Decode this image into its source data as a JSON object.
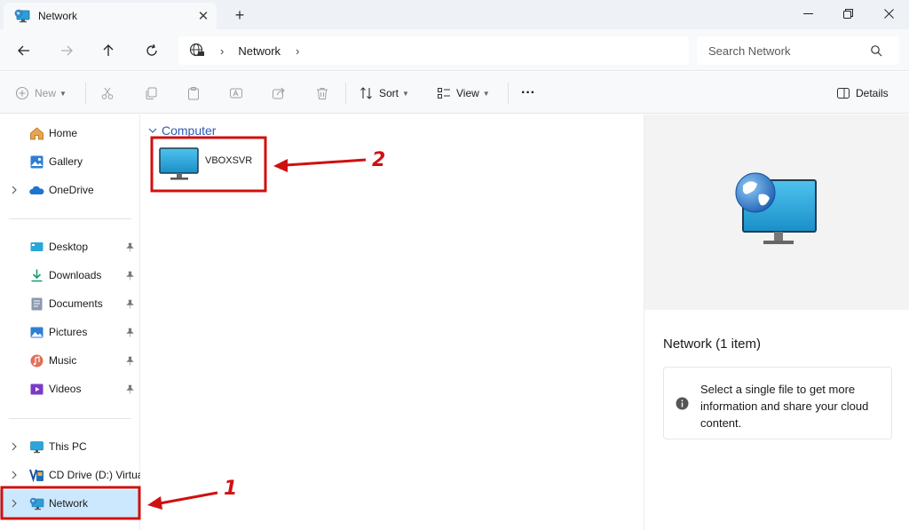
{
  "window": {
    "tab_title": "Network",
    "new_tab_symbol": "+",
    "close_symbol": "✕"
  },
  "address": {
    "breadcrumb": [
      "Network"
    ],
    "search_placeholder": "Search Network"
  },
  "toolbar": {
    "new_label": "New",
    "sort_label": "Sort",
    "view_label": "View",
    "more_label": "···",
    "details_label": "Details"
  },
  "sidebar": {
    "quick": [
      {
        "label": "Home",
        "icon": "home-icon"
      },
      {
        "label": "Gallery",
        "icon": "gallery-icon"
      },
      {
        "label": "OneDrive",
        "icon": "onedrive-icon"
      }
    ],
    "pinned": [
      {
        "label": "Desktop",
        "icon": "desktop-icon"
      },
      {
        "label": "Downloads",
        "icon": "downloads-icon"
      },
      {
        "label": "Documents",
        "icon": "documents-icon"
      },
      {
        "label": "Pictures",
        "icon": "pictures-icon"
      },
      {
        "label": "Music",
        "icon": "music-icon"
      },
      {
        "label": "Videos",
        "icon": "videos-icon"
      }
    ],
    "devices": [
      {
        "label": "This PC",
        "icon": "this-pc-icon"
      },
      {
        "label": "CD Drive (D:) VirtualBox Guest Additions",
        "icon": "cd-drive-icon"
      },
      {
        "label": "Network",
        "icon": "network-icon",
        "selected": true
      }
    ]
  },
  "content": {
    "group_header": "Computer",
    "items": [
      {
        "label": "VBOXSVR",
        "icon": "computer-icon"
      }
    ]
  },
  "details": {
    "title": "Network (1 item)",
    "info_text": "Select a single file to get more information and share your cloud content."
  },
  "annotations": {
    "label_1": "1",
    "label_2": "2",
    "color": "#d01010"
  },
  "colors": {
    "selection": "#cce8ff",
    "accent_blue": "#2a5bb0"
  }
}
